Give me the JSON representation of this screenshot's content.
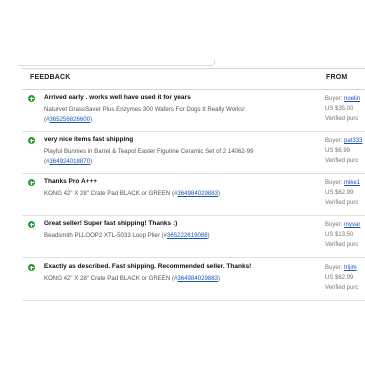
{
  "header": {
    "feedback_label": "FEEDBACK",
    "from_label": "FROM"
  },
  "rows": [
    {
      "comment": "Arrived early . works well have used it for years",
      "item_line1": "Naturvet GrassSaver Plus Enzymes 300 Wafers For Dogs It Really Works!",
      "item_prefix": "(#",
      "item_number": "365256826600",
      "item_suffix": ")",
      "buyer_prefix": "Buyer:",
      "buyer_name": "noelin",
      "price": "US $35.00",
      "status": "Verified purc"
    },
    {
      "comment": "very nice items fast shipping",
      "item_line1": "Playful Bunnies in Barrel & Teapot Easter Figurine Ceramic Set of 2 14062-99",
      "item_prefix": "(#",
      "item_number": "364924018870",
      "item_suffix": ")",
      "buyer_prefix": "Buyer:",
      "buyer_name": "pat333",
      "price": "US $6.99",
      "status": "Verified purc"
    },
    {
      "comment": "Thanks Pro A+++",
      "item_line1": "KONG 42\" X 28\" Crate Pad BLACK or GREEN (#",
      "item_number": "364984029883",
      "item_suffix": ")",
      "buyer_prefix": "Buyer:",
      "buyer_name": "mike1",
      "price": "US $62.99",
      "status": "Verified purc"
    },
    {
      "comment": "Great seller! Super fast shipping! Thanks :)",
      "item_line1": "Beadsmith PLLOOP2 XTL-5033 Loop Plier (#",
      "item_number": "365222619088",
      "item_suffix": ")",
      "buyer_prefix": "Buyer:",
      "buyer_name": "myvar",
      "price": "US $13.50",
      "status": "Verified purc"
    },
    {
      "comment": "Exactly as described. Fast shipping. Recommended seller. Thanks!",
      "item_line1": "KONG 42\" X 28\" Crate Pad BLACK or GREEN (#",
      "item_number": "364984029883",
      "item_suffix": ")",
      "buyer_prefix": "Buyer:",
      "buyer_name": "trijim",
      "price": "US $62.99",
      "status": "Verified purc"
    }
  ]
}
